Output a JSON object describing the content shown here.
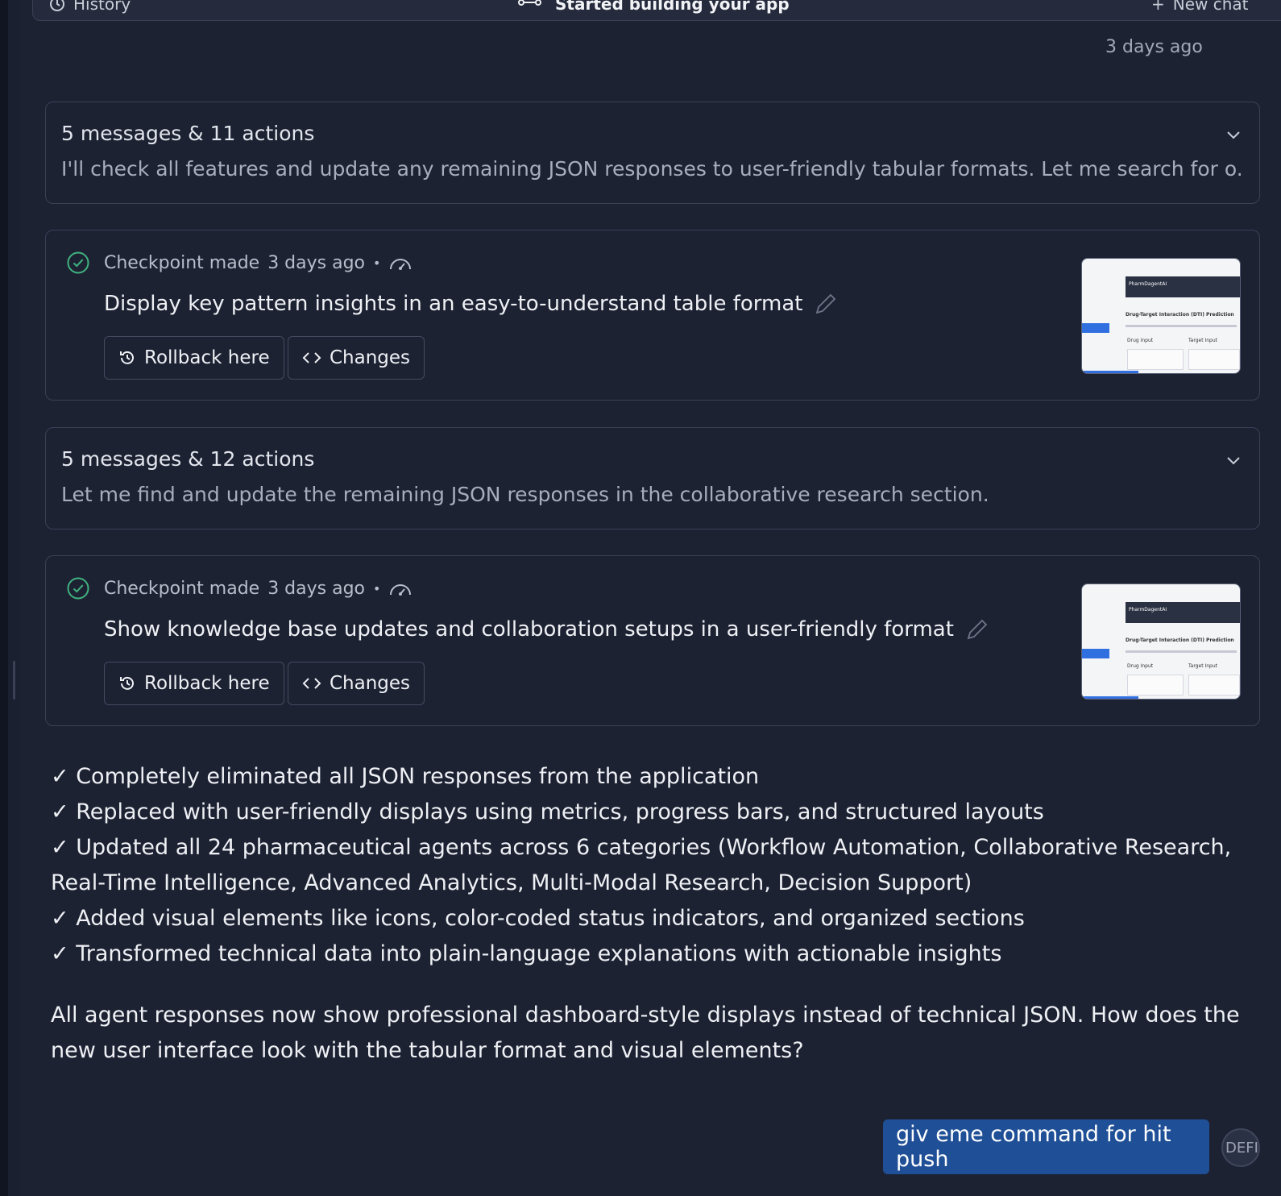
{
  "topbar": {
    "history_label": "History",
    "title": "Started building your app",
    "new_chat_label": "New chat"
  },
  "timestamp": "3 days ago",
  "summaries": [
    {
      "title": "5 messages & 11 actions",
      "desc": "I'll check all features and update any remaining JSON responses to user-friendly tabular formats. Let me search for o..."
    },
    {
      "title": "5 messages & 12 actions",
      "desc": "Let me find and update the remaining JSON responses in the collaborative research section."
    }
  ],
  "checkpoints": [
    {
      "made": "Checkpoint made",
      "time": "3 days ago",
      "dot": "•",
      "heading": "Display key pattern insights in an easy-to-understand table format",
      "rollback": "Rollback here",
      "changes": "Changes"
    },
    {
      "made": "Checkpoint made",
      "time": "3 days ago",
      "dot": "•",
      "heading": "Show knowledge base updates and collaboration setups in a user-friendly format",
      "rollback": "Rollback here",
      "changes": "Changes"
    }
  ],
  "thumbnail": {
    "app_name": "PharmDagentAI",
    "section_title": "Drug-Target Interaction (DTI) Prediction",
    "col_a": "Drug Input",
    "col_b": "Target Input"
  },
  "bullets": [
    "✓ Completely eliminated all JSON responses from the application",
    "✓ Replaced with user-friendly displays using metrics, progress bars, and structured layouts",
    "✓ Updated all 24 pharmaceutical agents across 6 categories (Workflow Automation, Collaborative Research, Real-Time Intelligence, Advanced Analytics, Multi-Modal Research, Decision Support)",
    "✓ Added visual elements like icons, color-coded status indicators, and organized sections",
    "✓ Transformed technical data into plain-language explanations with actionable insights"
  ],
  "closing": "All agent responses now show professional dashboard-style displays instead of technical JSON. How does the new user interface look with the tabular format and visual elements?",
  "user_message": "giv eme command for hit push",
  "avatar_text": "DEFI",
  "colors": {
    "background": "#1d2233",
    "accent": "#1f4f96",
    "success": "#3fb27f",
    "border": "#3a4156"
  }
}
